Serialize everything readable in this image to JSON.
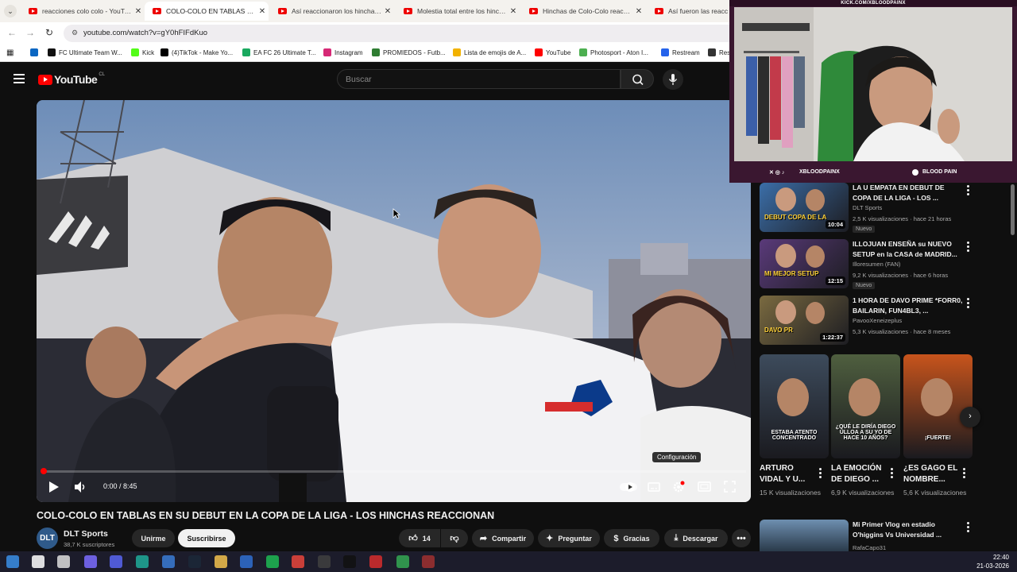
{
  "browser": {
    "tabs": [
      {
        "title": "reacciones colo colo - YouTube",
        "active": false
      },
      {
        "title": "COLO-COLO EN TABLAS EN SU",
        "active": true
      },
      {
        "title": "Así reaccionaron los hinchas al",
        "active": false
      },
      {
        "title": "Molestia total entre los hinchas",
        "active": false
      },
      {
        "title": "Hinchas de Colo-Colo reaccion",
        "active": false
      },
      {
        "title": "Así fueron las reacc",
        "active": false
      }
    ],
    "url": "youtube.com/watch?v=gY0hFIFdKuo",
    "bookmarks": [
      {
        "label": "",
        "color": "#0a66c2"
      },
      {
        "label": "FC Ultimate Team W...",
        "color": "#111111"
      },
      {
        "label": "Kick",
        "color": "#53fc18"
      },
      {
        "label": "(4)TikTok - Make Yo...",
        "color": "#000000"
      },
      {
        "label": "EA FC 26 Ultimate T...",
        "color": "#1aa95f"
      },
      {
        "label": "Instagram",
        "color": "#d62976"
      },
      {
        "label": "PROMIEDOS - Futb...",
        "color": "#2f7d32"
      },
      {
        "label": "Lista de emojis de A...",
        "color": "#f2b200"
      },
      {
        "label": "YouTube",
        "color": "#ff0000"
      },
      {
        "label": "Photosport - Aton I...",
        "color": "#4caf50"
      },
      {
        "label": "Restream",
        "color": "#2563eb"
      },
      {
        "label": "Res",
        "color": "#333333"
      }
    ]
  },
  "youtube": {
    "logo_text": "YouTube",
    "logo_region": "CL",
    "search_placeholder": "Buscar"
  },
  "player": {
    "time": "0:00 / 8:45",
    "progress": 0.0,
    "tooltip": "Configuración"
  },
  "video": {
    "title": "COLO-COLO EN TABLAS EN SU DEBUT EN LA COPA DE LA LIGA - LOS HINCHAS REACCIONAN",
    "channel": "DLT Sports",
    "avatar_text": "DLT",
    "subscribers": "38,7 K suscriptores",
    "join_label": "Unirme",
    "subscribe_label": "Suscribirse",
    "likes": "14",
    "share_label": "Compartir",
    "ask_label": "Preguntar",
    "thanks_label": "Gracias",
    "download_label": "Descargar"
  },
  "recommendations": [
    {
      "title": "LA U EMPATA EN DEBUT DE COPA DE LA LIGA - LOS ...",
      "channel": "DLT Sports",
      "meta": "2,5 K visualizaciones · hace 21 horas",
      "badge": "Nuevo",
      "duration": "10:04",
      "thumb_text": "DEBUT COPA DE LA",
      "thumb_color": "#3b6ea8"
    },
    {
      "title": "ILLOJUAN ENSEÑA su NUEVO SETUP en la CASA de MADRID...",
      "channel": "Illoresumen (FAN)",
      "meta": "9,2 K visualizaciones · hace 6 horas",
      "badge": "Nuevo",
      "duration": "12:15",
      "thumb_text": "MI MEJOR SETUP",
      "thumb_color": "#5a3a7a"
    },
    {
      "title": "1 HORA DE DAVO PRIME *FORR0, BAILARIN, FUN4BL3, ...",
      "channel": "PavooXeneizeplus",
      "meta": "5,3 K visualizaciones · hace 8 meses",
      "badge": "",
      "duration": "1:22:37",
      "thumb_text": "DAVO PR",
      "thumb_color": "#7a6a40"
    }
  ],
  "shorts": [
    {
      "title": "ARTURO VIDAL Y U...",
      "views": "15 K visualizaciones",
      "thumb_text": "ESTABA ATENTO CONCENTRADO",
      "thumb_color": "#3d4b5c"
    },
    {
      "title": "LA EMOCIÓN DE DIEGO ...",
      "views": "6,9 K visualizaciones",
      "thumb_text": "¿QUÉ LE DIRÍA DIEGO ULLOA A SU YO DE HACE 10 AÑOS?",
      "thumb_color": "#4f5f3f"
    },
    {
      "title": "¿ES GAGO EL NOMBRE...",
      "views": "5,6 K visualizaciones",
      "thumb_text": "¡FUERTE!",
      "thumb_color": "#c8541c"
    }
  ],
  "bottom_rec": {
    "title": "Mi Primer Vlog en estadio O'higgins Vs Universidad ...",
    "channel": "RafaCapo31",
    "thumb_color": "#6e8fb0"
  },
  "webcam": {
    "top_text": "KICK.COM/XBLOODPAINX",
    "handle_left": "XBLOODPAINX",
    "handle_right": "BLOOD PAIN"
  },
  "taskbar": {
    "time": "22:40",
    "date": "21-03-2026"
  }
}
